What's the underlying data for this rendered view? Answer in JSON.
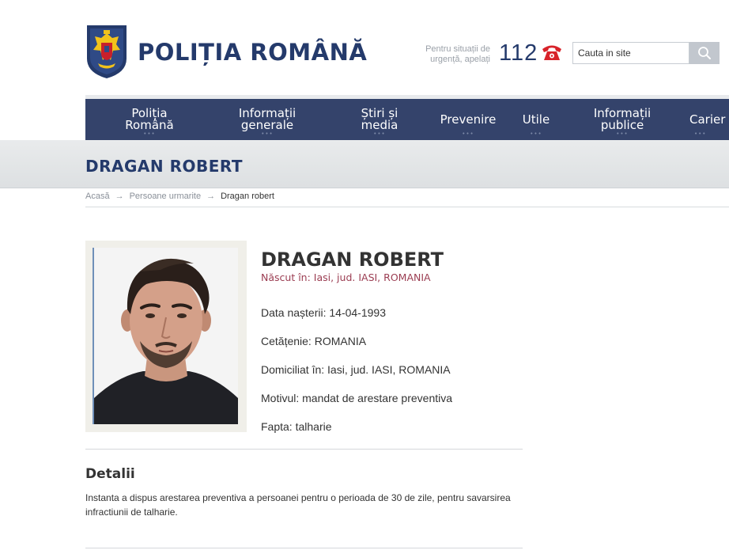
{
  "header": {
    "site_name": "POLIȚIA ROMÂNĂ",
    "emergency_text": "Pentru situații de urgență, apelați",
    "emergency_number": "112",
    "search_placeholder": "Cauta in site"
  },
  "nav": {
    "items": [
      {
        "label": "Poliția\nRomână"
      },
      {
        "label": "Informații\ngenerale"
      },
      {
        "label": "Știri și\nmedia"
      },
      {
        "label": "Prevenire"
      },
      {
        "label": "Utile"
      },
      {
        "label": "Informații\npublice"
      },
      {
        "label": "Carier"
      }
    ],
    "dots": "•••"
  },
  "page": {
    "title": "DRAGAN ROBERT"
  },
  "breadcrumb": {
    "home": "Acasă",
    "section": "Persoane urmarite",
    "current": "Dragan robert",
    "separator": "→"
  },
  "person": {
    "name": "DRAGAN ROBERT",
    "born": "Născut în: Iasi, jud. IASI, ROMANIA",
    "fields": [
      {
        "label": "Data nașterii:",
        "value": "14-04-1993"
      },
      {
        "label": "Cetățenie:",
        "value": "ROMANIA"
      },
      {
        "label": "Domiciliat în:",
        "value": "Iasi, jud. IASI, ROMANIA"
      },
      {
        "label": "Motivul:",
        "value": "mandat de arestare preventiva"
      },
      {
        "label": "Fapta:",
        "value": "talharie"
      }
    ]
  },
  "details": {
    "title": "Detalii",
    "text": "Instanta a dispus arestarea preventiva a persoanei pentru o perioada de 30 de zile, pentru savarsirea infractiunii de talharie."
  },
  "colors": {
    "brand_navy": "#243a6b",
    "nav_bg": "#34436b",
    "born_accent": "#9b3d52",
    "phone_red": "#d8232a"
  }
}
